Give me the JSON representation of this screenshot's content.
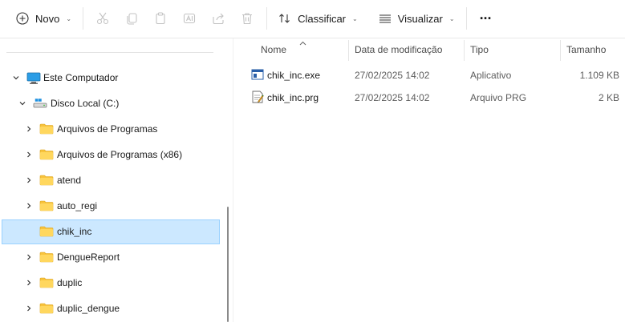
{
  "toolbar": {
    "new_label": "Novo",
    "sort_label": "Classificar",
    "view_label": "Visualizar",
    "more_label": "···"
  },
  "nav": {
    "this_pc": "Este Computador",
    "local_disk": "Disco Local (C:)",
    "folders": [
      {
        "label": "Arquivos de Programas",
        "selected": false,
        "has_children": true
      },
      {
        "label": "Arquivos de Programas (x86)",
        "selected": false,
        "has_children": true
      },
      {
        "label": "atend",
        "selected": false,
        "has_children": true
      },
      {
        "label": "auto_regi",
        "selected": false,
        "has_children": true
      },
      {
        "label": "chik_inc",
        "selected": true,
        "has_children": false
      },
      {
        "label": "DengueReport",
        "selected": false,
        "has_children": true
      },
      {
        "label": "duplic",
        "selected": false,
        "has_children": true
      },
      {
        "label": "duplic_dengue",
        "selected": false,
        "has_children": true
      }
    ]
  },
  "columns": {
    "name": "Nome",
    "modified": "Data de modificação",
    "type": "Tipo",
    "size": "Tamanho"
  },
  "files": [
    {
      "name": "chik_inc.exe",
      "modified": "27/02/2025 14:02",
      "type": "Aplicativo",
      "size": "1.109 KB",
      "icon": "exe-app-icon"
    },
    {
      "name": "chik_inc.prg",
      "modified": "27/02/2025 14:02",
      "type": "Arquivo PRG",
      "size": "2 KB",
      "icon": "prg-file-icon"
    }
  ],
  "colors": {
    "selection_bg": "#cce8ff",
    "selection_border": "#99d1ff",
    "folder_yellow": "#f8c33c"
  }
}
